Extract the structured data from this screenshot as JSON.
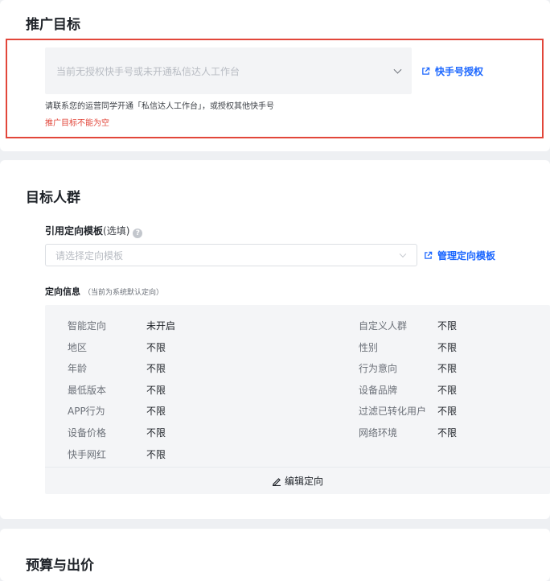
{
  "section1": {
    "title": "推广目标",
    "select_placeholder": "当前无授权快手号或未开通私信达人工作台",
    "auth_link": "快手号授权",
    "hint": "请联系您的运营同学开通「私信达人工作台」，或授权其他快手号",
    "error": "推广目标不能为空"
  },
  "section2": {
    "title": "目标人群",
    "template_label": "引用定向模板",
    "template_optional": "(选填)",
    "template_placeholder": "请选择定向模板",
    "manage_link": "管理定向模板",
    "info_label": "定向信息",
    "info_note": "（当前为系统默认定向）",
    "left_items": [
      {
        "key": "智能定向",
        "value": "未开启"
      },
      {
        "key": "地区",
        "value": "不限"
      },
      {
        "key": "年龄",
        "value": "不限"
      },
      {
        "key": "最低版本",
        "value": "不限"
      },
      {
        "key": "APP行为",
        "value": "不限"
      },
      {
        "key": "设备价格",
        "value": "不限"
      },
      {
        "key": "快手网红",
        "value": "不限"
      }
    ],
    "right_items": [
      {
        "key": "自定义人群",
        "value": "不限"
      },
      {
        "key": "性别",
        "value": "不限"
      },
      {
        "key": "行为意向",
        "value": "不限"
      },
      {
        "key": "设备品牌",
        "value": "不限"
      },
      {
        "key": "过滤已转化用户",
        "value": "不限"
      },
      {
        "key": "网络环境",
        "value": "不限"
      }
    ],
    "edit_label": "编辑定向"
  },
  "section3": {
    "title": "预算与出价"
  },
  "colors": {
    "accent": "#1a66ff",
    "error": "#e2463a"
  }
}
